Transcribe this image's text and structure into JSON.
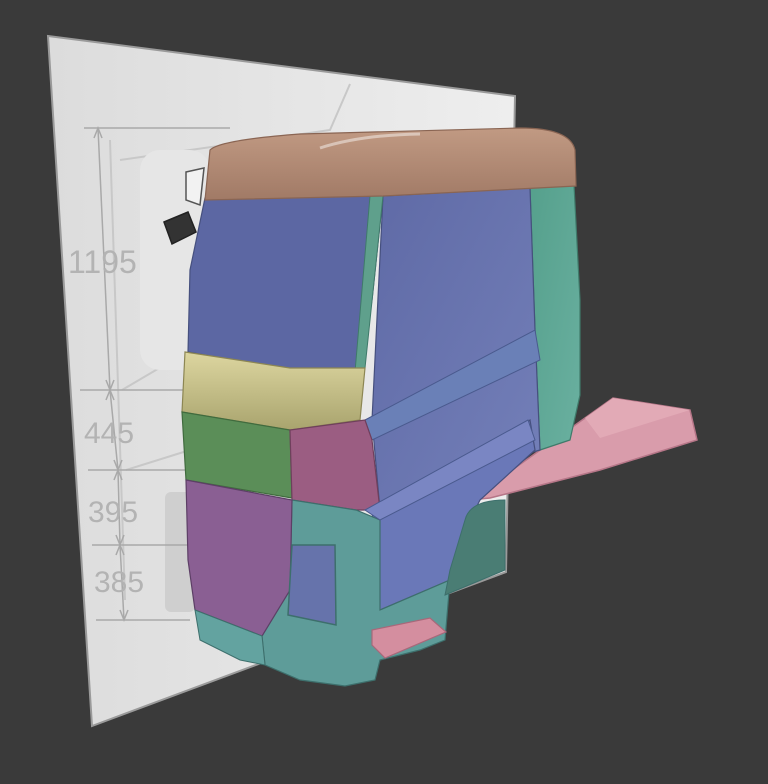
{
  "viewport": {
    "background": "#3a3a3a",
    "mode": "3d-viewport"
  },
  "blueprint": {
    "dimensions": [
      {
        "id": "dim-1195",
        "label": "1195"
      },
      {
        "id": "dim-445",
        "label": "445"
      },
      {
        "id": "dim-395",
        "label": "395"
      },
      {
        "id": "dim-385",
        "label": "385"
      }
    ]
  },
  "model": {
    "object": "truck-cab-mesh",
    "colors": {
      "roof": "#b08a73",
      "front_panel": "#6c78b0",
      "side_panel": "#5f9c8a",
      "visor_band": "#c4bd82",
      "lower_left": "#5c8f5a",
      "bumper_magenta": "#9a5c80",
      "lower_teal": "#5d9b98",
      "step_pink": "#d79aa8",
      "purple_panel": "#8a5f93"
    }
  }
}
